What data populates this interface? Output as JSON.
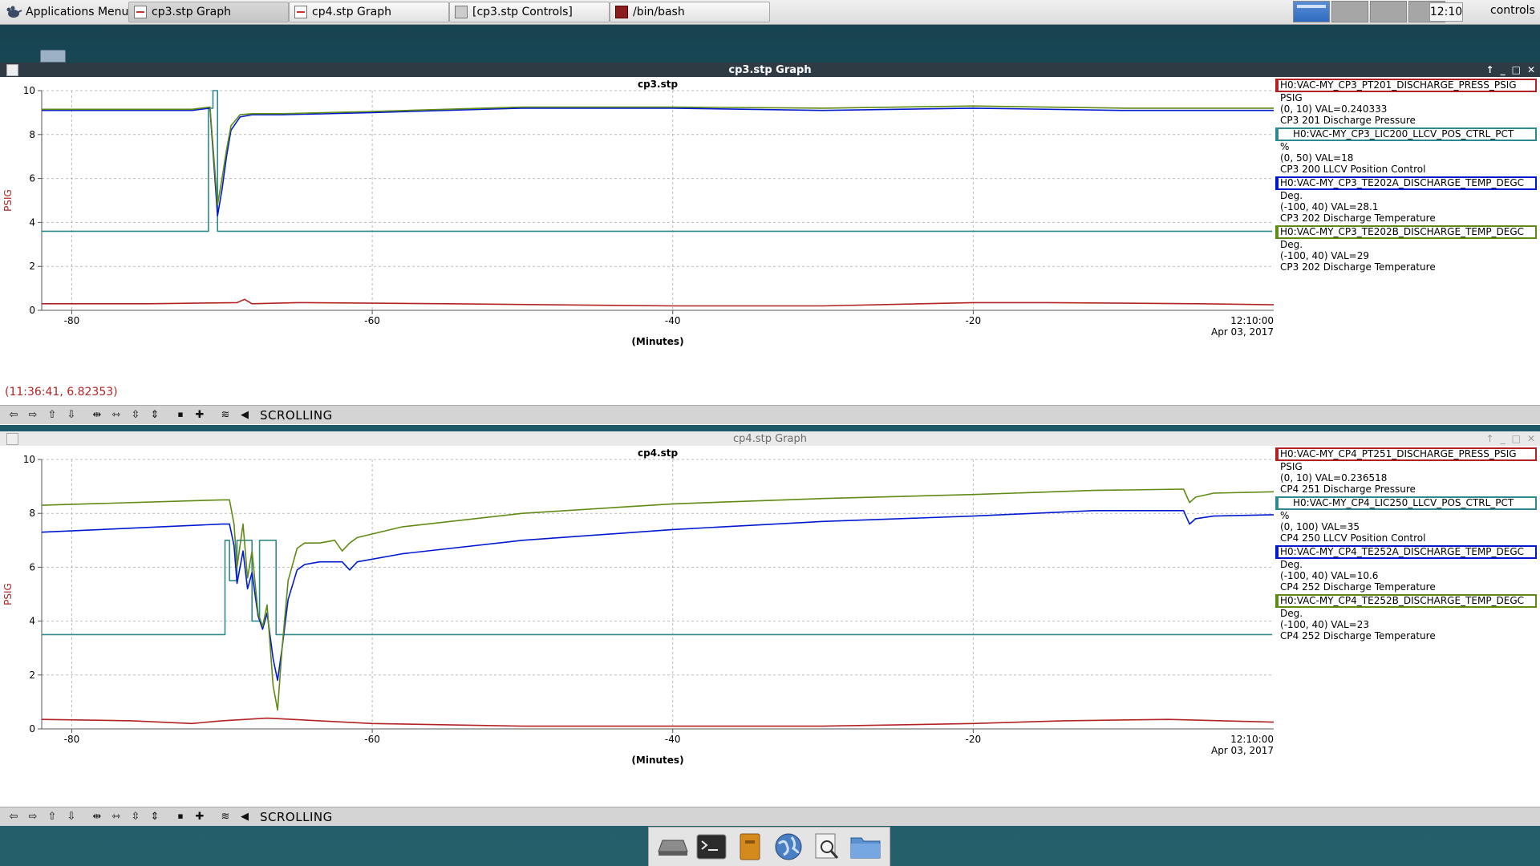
{
  "taskbar": {
    "app_menu": "Applications Menu",
    "tasks": [
      {
        "label": "cp3.stp Graph",
        "icon": "graph-icon",
        "active": true
      },
      {
        "label": "cp4.stp Graph",
        "icon": "graph-icon",
        "active": false
      },
      {
        "label": "[cp3.stp Controls]",
        "icon": "controls-icon",
        "active": false
      },
      {
        "label": "/bin/bash",
        "icon": "terminal-icon",
        "active": false
      }
    ],
    "clock": "12:10",
    "user": "controls"
  },
  "windows": [
    {
      "id": "cp3",
      "window_title": "cp3.stp Graph",
      "coord_readout": "(11:36:41, 6.82353)",
      "toolbar_mode": "SCROLLING",
      "legend": [
        {
          "channel": "H0:VAC-MY_CP3_PT201_DISCHARGE_PRESS_PSIG",
          "unit": "PSIG",
          "range_val": "(0, 10) VAL=0.240333",
          "desc": "CP3 201 Discharge Pressure",
          "color": "#b22222"
        },
        {
          "channel": "H0:VAC-MY_CP3_LIC200_LLCV_POS_CTRL_PCT",
          "unit": "%",
          "range_val": "(0, 50) VAL=18",
          "desc": "CP3 200 LLCV Position Control",
          "color": "#2e8a8e"
        },
        {
          "channel": "H0:VAC-MY_CP3_TE202A_DISCHARGE_TEMP_DEGC",
          "unit": "Deg.",
          "range_val": "(-100, 40) VAL=28.1",
          "desc": "CP3 202 Discharge Temperature",
          "color": "#0019d0"
        },
        {
          "channel": "H0:VAC-MY_CP3_TE202B_DISCHARGE_TEMP_DEGC",
          "unit": "Deg.",
          "range_val": "(-100, 40) VAL=29",
          "desc": "CP3 202 Discharge Temperature",
          "color": "#5f8a14"
        }
      ],
      "chart_data": {
        "type": "line",
        "title": "cp3.stp",
        "xlabel": "(Minutes)",
        "ylabel": "PSIG",
        "end_time": "12:10:00",
        "end_date": "Apr 03, 2017",
        "xlim": [
          -82,
          0
        ],
        "ylim": [
          0,
          10
        ],
        "x_ticks": [
          "-80",
          "-60",
          "-40",
          "-20"
        ],
        "y_ticks": [
          "0",
          "2",
          "4",
          "6",
          "8",
          "10"
        ],
        "grid": true,
        "series": [
          {
            "name": "H0:VAC-MY_CP3_PT201_DISCHARGE_PRESS_PSIG",
            "color": "#b22222",
            "x": [
              -82,
              -75,
              -69,
              -68.5,
              -68,
              -65,
              -55,
              -40,
              -30,
              -20,
              -15,
              -5,
              0
            ],
            "y": [
              0.3,
              0.3,
              0.35,
              0.5,
              0.3,
              0.35,
              0.3,
              0.2,
              0.2,
              0.35,
              0.35,
              0.3,
              0.25
            ]
          },
          {
            "name": "H0:VAC-MY_CP3_LIC200_LLCV_POS_CTRL_PCT",
            "color": "#2e8a8e",
            "x": [
              -82,
              -70.9,
              -70.9,
              -70.6,
              -70.6,
              -70.3,
              -70.3,
              -0.1
            ],
            "y": [
              3.6,
              3.6,
              9.2,
              9.2,
              10,
              10,
              3.6,
              3.6
            ]
          },
          {
            "name": "H0:VAC-MY_CP3_TE202A_DISCHARGE_TEMP_DEGC",
            "color": "#0019d0",
            "x": [
              -82,
              -72,
              -70.8,
              -70.3,
              -70.0,
              -69.7,
              -69.4,
              -68.8,
              -68,
              -66,
              -60,
              -50,
              -40,
              -30,
              -20,
              -10,
              0
            ],
            "y": [
              9.1,
              9.1,
              9.2,
              4.3,
              5.5,
              7.0,
              8.2,
              8.8,
              8.9,
              8.9,
              9.0,
              9.2,
              9.2,
              9.1,
              9.2,
              9.1,
              9.1
            ]
          },
          {
            "name": "H0:VAC-MY_CP3_TE202B_DISCHARGE_TEMP_DEGC",
            "color": "#5f8a14",
            "x": [
              -82,
              -72,
              -70.8,
              -70.3,
              -70.0,
              -69.7,
              -69.4,
              -68.8,
              -68,
              -66,
              -60,
              -50,
              -40,
              -30,
              -20,
              -10,
              0
            ],
            "y": [
              9.15,
              9.15,
              9.25,
              4.8,
              6.0,
              7.3,
              8.4,
              8.9,
              8.95,
              8.95,
              9.05,
              9.25,
              9.25,
              9.2,
              9.3,
              9.2,
              9.2
            ]
          }
        ]
      }
    },
    {
      "id": "cp4",
      "window_title": "cp4.stp Graph",
      "coord_readout": "",
      "toolbar_mode": "SCROLLING",
      "legend": [
        {
          "channel": "H0:VAC-MY_CP4_PT251_DISCHARGE_PRESS_PSIG",
          "unit": "PSIG",
          "range_val": "(0, 10) VAL=0.236518",
          "desc": "CP4 251 Discharge Pressure",
          "color": "#b22222"
        },
        {
          "channel": "H0:VAC-MY_CP4_LIC250_LLCV_POS_CTRL_PCT",
          "unit": "%",
          "range_val": "(0, 100) VAL=35",
          "desc": "CP4 250 LLCV Position Control",
          "color": "#2e8a8e"
        },
        {
          "channel": "H0:VAC-MY_CP4_TE252A_DISCHARGE_TEMP_DEGC",
          "unit": "Deg.",
          "range_val": "(-100, 40) VAL=10.6",
          "desc": "CP4 252 Discharge Temperature",
          "color": "#0019d0"
        },
        {
          "channel": "H0:VAC-MY_CP4_TE252B_DISCHARGE_TEMP_DEGC",
          "unit": "Deg.",
          "range_val": "(-100, 40) VAL=23",
          "desc": "CP4 252 Discharge Temperature",
          "color": "#5f8a14"
        }
      ],
      "chart_data": {
        "type": "line",
        "title": "cp4.stp",
        "xlabel": "(Minutes)",
        "ylabel": "PSIG",
        "end_time": "12:10:00",
        "end_date": "Apr 03, 2017",
        "xlim": [
          -82,
          0
        ],
        "ylim": [
          0,
          10
        ],
        "x_ticks": [
          "-80",
          "-60",
          "-40",
          "-20"
        ],
        "y_ticks": [
          "0",
          "2",
          "4",
          "6",
          "8",
          "10"
        ],
        "grid": true,
        "series": [
          {
            "name": "H0:VAC-MY_CP4_PT251_DISCHARGE_PRESS_PSIG",
            "color": "#b22222",
            "x": [
              -82,
              -76,
              -72,
              -70,
              -67,
              -60,
              -50,
              -40,
              -30,
              -20,
              -14,
              -7,
              0
            ],
            "y": [
              0.35,
              0.3,
              0.2,
              0.3,
              0.4,
              0.2,
              0.1,
              0.1,
              0.1,
              0.2,
              0.3,
              0.35,
              0.25
            ]
          },
          {
            "name": "H0:VAC-MY_CP4_LIC250_LLCV_POS_CTRL_PCT",
            "color": "#2e8a8e",
            "x": [
              -82,
              -69.8,
              -69.8,
              -69.5,
              -69.5,
              -69.0,
              -69.0,
              -68.0,
              -68.0,
              -67.5,
              -67.5,
              -66.4,
              -66.4,
              -0.1
            ],
            "y": [
              3.5,
              3.5,
              7.0,
              7.0,
              5.5,
              5.5,
              7.0,
              7.0,
              4.0,
              4.0,
              7.0,
              7.0,
              3.5,
              3.5
            ]
          },
          {
            "name": "H0:VAC-MY_CP4_TE252A_DISCHARGE_TEMP_DEGC",
            "color": "#0019d0",
            "x": [
              -82,
              -70,
              -69.5,
              -69.2,
              -69.0,
              -68.6,
              -68.3,
              -68.0,
              -67.6,
              -67.3,
              -67.0,
              -66.6,
              -66.3,
              -66.0,
              -65.6,
              -65.0,
              -64.5,
              -63.5,
              -62.0,
              -61.5,
              -61.0,
              -58,
              -50,
              -40,
              -30,
              -20,
              -12,
              -6,
              -5.6,
              -5.2,
              -4,
              0
            ],
            "y": [
              7.3,
              7.6,
              7.6,
              6.8,
              5.4,
              6.6,
              5.2,
              5.8,
              4.2,
              3.7,
              4.3,
              2.6,
              1.8,
              3.0,
              4.8,
              5.9,
              6.1,
              6.2,
              6.2,
              5.9,
              6.2,
              6.5,
              7.0,
              7.4,
              7.7,
              7.9,
              8.1,
              8.1,
              7.6,
              7.8,
              7.9,
              7.95
            ]
          },
          {
            "name": "H0:VAC-MY_CP4_TE252B_DISCHARGE_TEMP_DEGC",
            "color": "#5f8a14",
            "x": [
              -82,
              -70,
              -69.5,
              -69.2,
              -69.0,
              -68.6,
              -68.3,
              -68.0,
              -67.6,
              -67.3,
              -67.0,
              -66.6,
              -66.3,
              -66.0,
              -65.6,
              -65.0,
              -64.5,
              -63.5,
              -62.5,
              -62.0,
              -61.5,
              -61.0,
              -58,
              -50,
              -40,
              -30,
              -20,
              -12,
              -6,
              -5.6,
              -5.2,
              -4,
              0
            ],
            "y": [
              8.3,
              8.5,
              8.5,
              7.6,
              6.0,
              7.6,
              5.6,
              6.6,
              4.3,
              3.8,
              4.6,
              1.6,
              0.7,
              3.0,
              5.5,
              6.7,
              6.9,
              6.9,
              7.0,
              6.6,
              6.9,
              7.1,
              7.5,
              8.0,
              8.35,
              8.55,
              8.7,
              8.85,
              8.9,
              8.4,
              8.6,
              8.75,
              8.8
            ]
          }
        ]
      }
    }
  ],
  "toolbar_icons": [
    "scroll-left-icon",
    "scroll-right-icon",
    "scroll-up-icon",
    "scroll-down-icon",
    "expand-x-icon",
    "compress-x-icon",
    "expand-y-icon",
    "compress-y-icon",
    "stop-icon",
    "zoom-in-icon",
    "fit-icon",
    "back-icon"
  ],
  "dock_icons": [
    "drive-icon",
    "terminal-icon",
    "file-manager-icon",
    "web-browser-icon",
    "search-icon",
    "folder-icon"
  ]
}
